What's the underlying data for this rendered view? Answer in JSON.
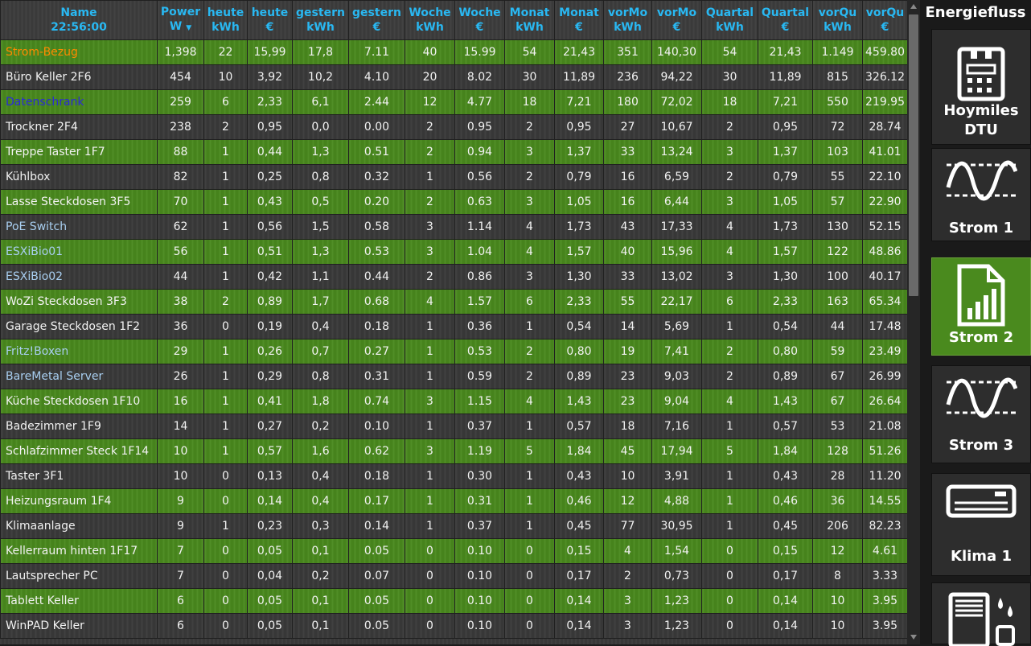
{
  "columns": [
    {
      "l1": "Name",
      "l2": "22:56:00"
    },
    {
      "l1": "Power",
      "l2": "W",
      "sorted": true
    },
    {
      "l1": "heute",
      "l2": "kWh"
    },
    {
      "l1": "heute",
      "l2": "€"
    },
    {
      "l1": "gestern",
      "l2": "kWh"
    },
    {
      "l1": "gestern",
      "l2": "€"
    },
    {
      "l1": "Woche",
      "l2": "kWh"
    },
    {
      "l1": "Woche",
      "l2": "€"
    },
    {
      "l1": "Monat",
      "l2": "kWh"
    },
    {
      "l1": "Monat",
      "l2": "€"
    },
    {
      "l1": "vorMo",
      "l2": "kWh"
    },
    {
      "l1": "vorMo",
      "l2": "€"
    },
    {
      "l1": "Quartal",
      "l2": "kWh"
    },
    {
      "l1": "Quartal",
      "l2": "€"
    },
    {
      "l1": "vorQu",
      "l2": "kWh"
    },
    {
      "l1": "vorQu",
      "l2": "€"
    }
  ],
  "sort_indicator": "▼",
  "rows": [
    {
      "name": "Strom-Bezug",
      "color": "#ff8a00",
      "cells": [
        "1,398",
        "22",
        "15,99",
        "17,8",
        "7.11",
        "40",
        "15.99",
        "54",
        "21,43",
        "351",
        "140,30",
        "54",
        "21,43",
        "1.149",
        "459.80"
      ]
    },
    {
      "name": "Büro Keller 2F6",
      "color": "#f2f2f2",
      "cells": [
        "454",
        "10",
        "3,92",
        "10,2",
        "4.10",
        "20",
        "8.02",
        "30",
        "11,89",
        "236",
        "94,22",
        "30",
        "11,89",
        "815",
        "326.12"
      ]
    },
    {
      "name": "Datenschrank",
      "color": "#2a2ad8",
      "cells": [
        "259",
        "6",
        "2,33",
        "6,1",
        "2.44",
        "12",
        "4.77",
        "18",
        "7,21",
        "180",
        "72,02",
        "18",
        "7,21",
        "550",
        "219.95"
      ]
    },
    {
      "name": "Trockner 2F4",
      "color": "#f2f2f2",
      "cells": [
        "238",
        "2",
        "0,95",
        "0,0",
        "0.00",
        "2",
        "0.95",
        "2",
        "0,95",
        "27",
        "10,67",
        "2",
        "0,95",
        "72",
        "28.74"
      ]
    },
    {
      "name": "Treppe Taster 1F7",
      "color": "#f2f2f2",
      "cells": [
        "88",
        "1",
        "0,44",
        "1,3",
        "0.51",
        "2",
        "0.94",
        "3",
        "1,37",
        "33",
        "13,24",
        "3",
        "1,37",
        "103",
        "41.01"
      ]
    },
    {
      "name": "Kühlbox",
      "color": "#f2f2f2",
      "cells": [
        "82",
        "1",
        "0,25",
        "0,8",
        "0.32",
        "1",
        "0.56",
        "2",
        "0,79",
        "16",
        "6,59",
        "2",
        "0,79",
        "55",
        "22.10"
      ]
    },
    {
      "name": "Lasse Steckdosen 3F5",
      "color": "#f2f2f2",
      "cells": [
        "70",
        "1",
        "0,43",
        "0,5",
        "0.20",
        "2",
        "0.63",
        "3",
        "1,05",
        "16",
        "6,44",
        "3",
        "1,05",
        "57",
        "22.90"
      ]
    },
    {
      "name": "PoE Switch",
      "color": "#a8cef0",
      "cells": [
        "62",
        "1",
        "0,56",
        "1,5",
        "0.58",
        "3",
        "1.14",
        "4",
        "1,73",
        "43",
        "17,33",
        "4",
        "1,73",
        "130",
        "52.15"
      ]
    },
    {
      "name": "ESXiBio01",
      "color": "#a8cef0",
      "cells": [
        "56",
        "1",
        "0,51",
        "1,3",
        "0.53",
        "3",
        "1.04",
        "4",
        "1,57",
        "40",
        "15,96",
        "4",
        "1,57",
        "122",
        "48.86"
      ]
    },
    {
      "name": "ESXiBio02",
      "color": "#a8cef0",
      "cells": [
        "44",
        "1",
        "0,42",
        "1,1",
        "0.44",
        "2",
        "0.86",
        "3",
        "1,30",
        "33",
        "13,02",
        "3",
        "1,30",
        "100",
        "40.17"
      ]
    },
    {
      "name": "WoZi Steckdosen 3F3",
      "color": "#f2f2f2",
      "cells": [
        "38",
        "2",
        "0,89",
        "1,7",
        "0.68",
        "4",
        "1.57",
        "6",
        "2,33",
        "55",
        "22,17",
        "6",
        "2,33",
        "163",
        "65.34"
      ]
    },
    {
      "name": "Garage Steckdosen 1F2",
      "color": "#f2f2f2",
      "cells": [
        "36",
        "0",
        "0,19",
        "0,4",
        "0.18",
        "1",
        "0.36",
        "1",
        "0,54",
        "14",
        "5,69",
        "1",
        "0,54",
        "44",
        "17.48"
      ]
    },
    {
      "name": "Fritz!Boxen",
      "color": "#a8cef0",
      "cells": [
        "29",
        "1",
        "0,26",
        "0,7",
        "0.27",
        "1",
        "0.53",
        "2",
        "0,80",
        "19",
        "7,41",
        "2",
        "0,80",
        "59",
        "23.49"
      ]
    },
    {
      "name": "BareMetal Server",
      "color": "#a8cef0",
      "cells": [
        "26",
        "1",
        "0,29",
        "0,8",
        "0.31",
        "1",
        "0.59",
        "2",
        "0,89",
        "23",
        "9,03",
        "2",
        "0,89",
        "67",
        "26.99"
      ]
    },
    {
      "name": "Küche Steckdosen 1F10",
      "color": "#f2f2f2",
      "cells": [
        "16",
        "1",
        "0,41",
        "1,8",
        "0.74",
        "3",
        "1.15",
        "4",
        "1,43",
        "23",
        "9,04",
        "4",
        "1,43",
        "67",
        "26.64"
      ]
    },
    {
      "name": "Badezimmer 1F9",
      "color": "#f2f2f2",
      "cells": [
        "14",
        "1",
        "0,27",
        "0,2",
        "0.10",
        "1",
        "0.37",
        "1",
        "0,57",
        "18",
        "7,16",
        "1",
        "0,57",
        "53",
        "21.08"
      ]
    },
    {
      "name": "Schlafzimmer Steck 1F14",
      "color": "#f2f2f2",
      "cells": [
        "10",
        "1",
        "0,57",
        "1,6",
        "0.62",
        "3",
        "1.19",
        "5",
        "1,84",
        "45",
        "17,94",
        "5",
        "1,84",
        "128",
        "51.26"
      ]
    },
    {
      "name": "Taster 3F1",
      "color": "#f2f2f2",
      "cells": [
        "10",
        "0",
        "0,13",
        "0,4",
        "0.18",
        "1",
        "0.30",
        "1",
        "0,43",
        "10",
        "3,91",
        "1",
        "0,43",
        "28",
        "11.20"
      ]
    },
    {
      "name": "Heizungsraum 1F4",
      "color": "#f2f2f2",
      "cells": [
        "9",
        "0",
        "0,14",
        "0,4",
        "0.17",
        "1",
        "0.31",
        "1",
        "0,46",
        "12",
        "4,88",
        "1",
        "0,46",
        "36",
        "14.55"
      ]
    },
    {
      "name": "Klimaanlage",
      "color": "#f2f2f2",
      "cells": [
        "9",
        "1",
        "0,23",
        "0,3",
        "0.14",
        "1",
        "0.37",
        "1",
        "0,45",
        "77",
        "30,95",
        "1",
        "0,45",
        "206",
        "82.23"
      ]
    },
    {
      "name": "Kellerraum hinten 1F17",
      "color": "#f2f2f2",
      "cells": [
        "7",
        "0",
        "0,05",
        "0,1",
        "0.05",
        "0",
        "0.10",
        "0",
        "0,15",
        "4",
        "1,54",
        "0",
        "0,15",
        "12",
        "4.61"
      ]
    },
    {
      "name": "Lautsprecher PC",
      "color": "#f2f2f2",
      "cells": [
        "7",
        "0",
        "0,04",
        "0,2",
        "0.07",
        "0",
        "0.10",
        "0",
        "0,17",
        "2",
        "0,73",
        "0",
        "0,17",
        "8",
        "3.33"
      ]
    },
    {
      "name": "Tablett Keller",
      "color": "#f2f2f2",
      "cells": [
        "6",
        "0",
        "0,05",
        "0,1",
        "0.05",
        "0",
        "0.10",
        "0",
        "0,14",
        "3",
        "1,23",
        "0",
        "0,14",
        "10",
        "3.95"
      ]
    },
    {
      "name": "WinPAD Keller",
      "color": "#f2f2f2",
      "cells": [
        "6",
        "0",
        "0,05",
        "0,1",
        "0.05",
        "0",
        "0.10",
        "0",
        "0,14",
        "3",
        "1,23",
        "0",
        "0,14",
        "10",
        "3.95"
      ]
    }
  ],
  "sidebar": {
    "title": "Energiefluss",
    "tiles": [
      {
        "label": "Hoymiles DTU",
        "label_lines": [
          "Hoymiles",
          "DTU"
        ],
        "icon": "dtu-device-icon"
      },
      {
        "label": "Strom 1",
        "icon": "sine-wave-icon"
      },
      {
        "label": "Strom 2",
        "icon": "chart-document-icon",
        "active": true
      },
      {
        "label": "Strom 3",
        "icon": "sine-wave-icon"
      },
      {
        "label": "Klima 1",
        "icon": "air-conditioner-icon"
      },
      {
        "label": "",
        "icon": "dehumidifier-icon"
      }
    ]
  },
  "colors": {
    "green_row": "#4a8a1e",
    "dark_row": "#3a3a3a",
    "header_text": "#29b8f2",
    "active_tile": "#4a8a1e"
  }
}
